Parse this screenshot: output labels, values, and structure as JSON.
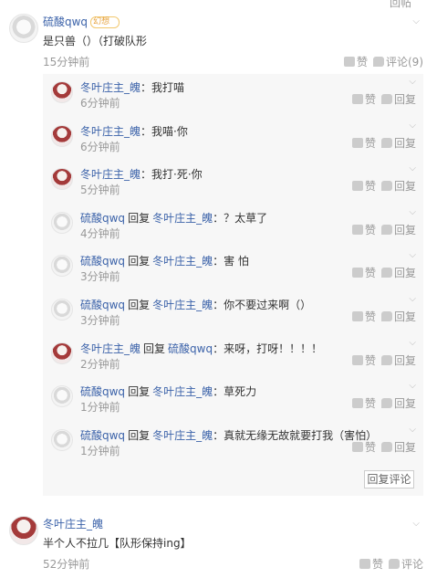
{
  "top_reply_label": "回帖",
  "post1": {
    "author": "硫酸qwq",
    "badge": "幻想",
    "text": "是只兽（）（打破队形",
    "time": "15分钟前",
    "like_label": "赞",
    "comment_label": "评论(9)"
  },
  "replies": [
    {
      "author": "冬叶庄主_魄",
      "reply_to": "",
      "text": "：我打喵",
      "time": "6分钟前",
      "avatar": "girl"
    },
    {
      "author": "冬叶庄主_魄",
      "reply_to": "",
      "text": "：我喵·你",
      "time": "6分钟前",
      "avatar": "girl"
    },
    {
      "author": "冬叶庄主_魄",
      "reply_to": "",
      "text": "：我打·死·你",
      "time": "5分钟前",
      "avatar": "girl"
    },
    {
      "author": "硫酸qwq",
      "reply_to": "冬叶庄主_魄",
      "text": "：？太草了",
      "time": "4分钟前",
      "avatar": "ghost"
    },
    {
      "author": "硫酸qwq",
      "reply_to": "冬叶庄主_魄",
      "text": "：害 怕",
      "time": "3分钟前",
      "avatar": "ghost"
    },
    {
      "author": "硫酸qwq",
      "reply_to": "冬叶庄主_魄",
      "text": "：你不要过来啊（）",
      "time": "3分钟前",
      "avatar": "ghost"
    },
    {
      "author": "冬叶庄主_魄",
      "reply_to": "硫酸qwq",
      "text": "：来呀，打呀！！！！",
      "time": "2分钟前",
      "avatar": "girl"
    },
    {
      "author": "硫酸qwq",
      "reply_to": "冬叶庄主_魄",
      "text": "：草死力",
      "time": "1分钟前",
      "avatar": "ghost"
    },
    {
      "author": "硫酸qwq",
      "reply_to": "冬叶庄主_魄",
      "text": "：真就无缘无故就要打我（害怕）",
      "time": "1分钟前",
      "avatar": "ghost"
    }
  ],
  "reply_verb": "回复",
  "reply_like_label": "赞",
  "reply_reply_label": "回复",
  "reply_comment_button": "回复评论",
  "post2": {
    "author": "冬叶庄主_魄",
    "text": "半个人不拉几【队形保持ing】",
    "time": "52分钟前",
    "like_label": "赞",
    "comment_label": "评论"
  }
}
